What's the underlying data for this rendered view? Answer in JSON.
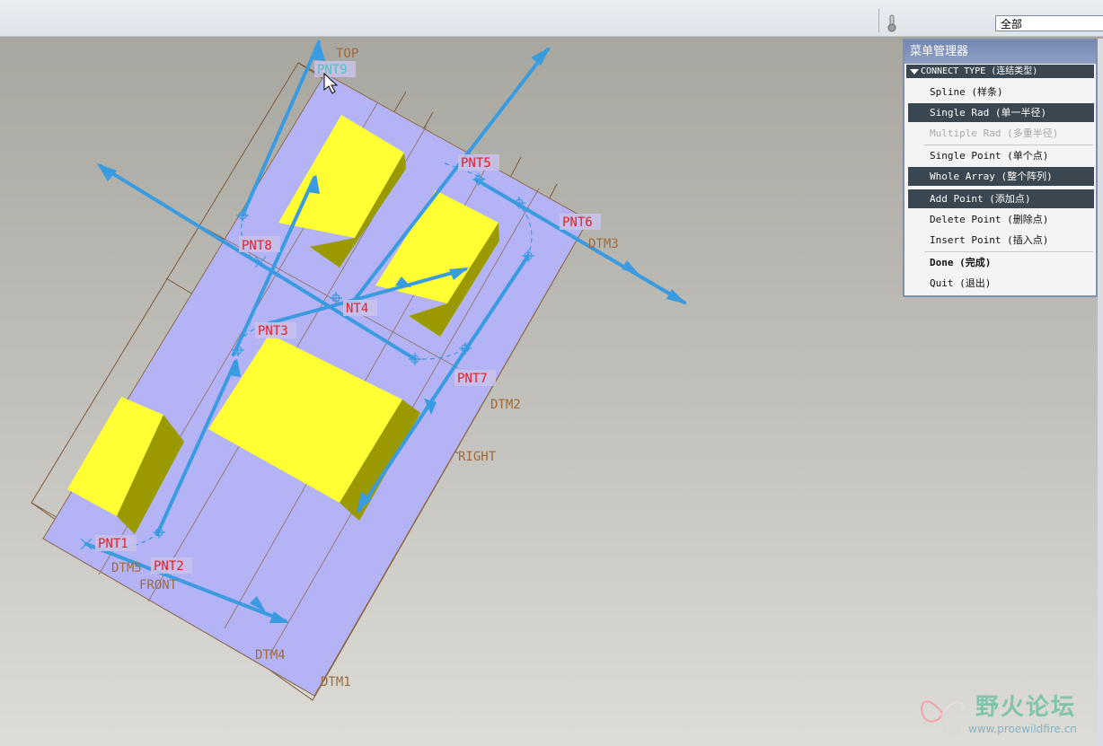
{
  "toolbar": {
    "filter_value": "全部"
  },
  "model_labels": {
    "pnt9": "PNT9",
    "pnt5": "PNT5",
    "pnt6": "PNT6",
    "pnt8": "PNT8",
    "pnt4": "NT4",
    "pnt3": "PNT3",
    "pnt7": "PNT7",
    "pnt1": "PNT1",
    "pnt2": "PNT2",
    "top": "TOP",
    "dtm3": "DTM3",
    "dtm2": "DTM2",
    "right": "RIGHT",
    "dtm5": "DTM5",
    "front": "FRONT",
    "dtm4": "DTM4",
    "dtm1": "DTM1"
  },
  "menu": {
    "title": "菜单管理器",
    "section": "CONNECT TYPE (连结类型)",
    "items": [
      {
        "label": "Spline (样条)",
        "state": "normal"
      },
      {
        "label": "Single Rad (单一半径)",
        "state": "selected"
      },
      {
        "label": "Multiple Rad (多重半径)",
        "state": "disabled"
      },
      {
        "label": "Single Point (单个点)",
        "state": "normal"
      },
      {
        "label": "Whole Array (整个阵列)",
        "state": "selected"
      },
      {
        "label": "Add Point (添加点)",
        "state": "selected"
      },
      {
        "label": "Delete Point (删除点)",
        "state": "normal"
      },
      {
        "label": "Insert Point (插入点)",
        "state": "normal"
      },
      {
        "label": "Done (完成)",
        "state": "bold"
      },
      {
        "label": "Quit (退出)",
        "state": "normal"
      }
    ]
  },
  "watermark": {
    "title": "野火论坛",
    "url": "www.proewildfire.cn"
  },
  "colors": {
    "plate": "#b3b3f6",
    "block_top": "#ffff33",
    "block_side": "#9a9a00",
    "path": "#3a9be0"
  }
}
